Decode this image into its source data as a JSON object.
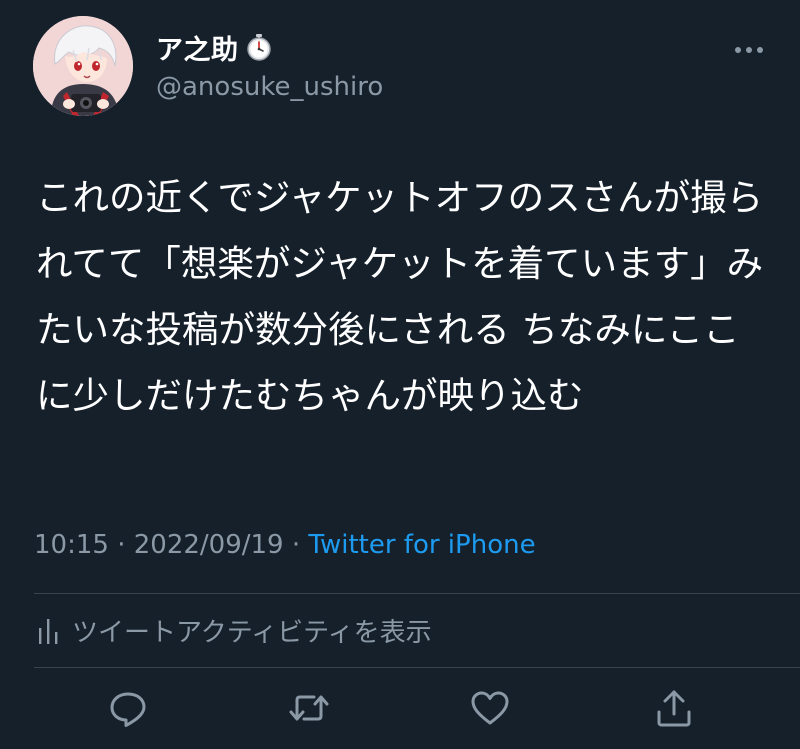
{
  "user": {
    "display_name": "ア之助",
    "handle": "@anosuke_ushiro"
  },
  "tweet": {
    "text": "これの近くでジャケットオフのスさんが撮られてて「想楽がジャケットを着ています」みたいな投稿が数分後にされる ちなみにここに少しだけたむちゃんが映り込む"
  },
  "meta": {
    "time": "10:15",
    "separator1": " · ",
    "date": "2022/09/19",
    "separator2": " · ",
    "source": "Twitter for iPhone"
  },
  "activity": {
    "label": "ツイートアクティビティを表示"
  },
  "icons": {
    "badge": "stopwatch-icon",
    "more": "more-icon",
    "activity": "bars-icon",
    "reply": "reply-icon",
    "retweet": "retweet-icon",
    "like": "heart-icon",
    "share": "share-icon"
  },
  "colors": {
    "background": "#15202b",
    "text": "#ffffff",
    "secondary": "#8b98a5",
    "link": "#1d9bf0",
    "divider": "#38444d"
  }
}
